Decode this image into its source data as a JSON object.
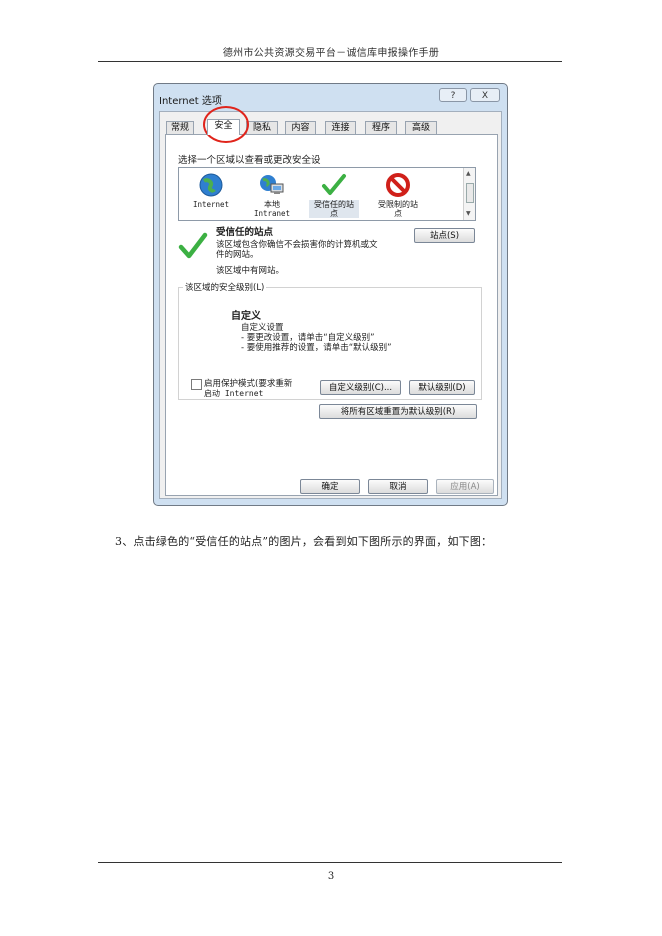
{
  "document": {
    "header": "德州市公共资源交易平台－诚信库申报操作手册",
    "paragraph": "3、点击绿色的“受信任的站点”的图片，会看到如下图所示的界面，如下图：",
    "page_number": "3"
  },
  "dialog": {
    "title": "Internet 选项",
    "help_button": "?",
    "close_button": "X",
    "tabs": [
      "常规",
      "安全",
      "隐私",
      "内容",
      "连接",
      "程序",
      "高级"
    ],
    "active_tab": "安全",
    "zone_prompt": "选择一个区域以查看或更改安全设",
    "zones": [
      {
        "line1": "Internet",
        "line2": "",
        "icon": "globe-icon"
      },
      {
        "line1": "本地",
        "line2": "Intranet",
        "icon": "intranet-icon"
      },
      {
        "line1": "受信任的站",
        "line2": "点",
        "icon": "check-icon",
        "selected": true
      },
      {
        "line1": "受限制的站",
        "line2": "点",
        "icon": "restricted-icon"
      }
    ],
    "selected_zone": {
      "title": "受信任的站点",
      "desc_line1": "该区域包含你确信不会损害你的计算机或文",
      "desc_line2": "件的网站。",
      "desc_line3": "该区域中有网站。",
      "sites_button": "站点(S)"
    },
    "security_level": {
      "group_label": "该区域的安全级别(L)",
      "level_title": "自定义",
      "line1": "自定义设置",
      "line2": "- 要更改设置，请单击“自定义级别”",
      "line3": "- 要使用推荐的设置，请单击“默认级别”"
    },
    "protected_mode": {
      "label_line1": "启用保护模式(要求重新",
      "label_line2": "启动 Internet",
      "checked": false
    },
    "custom_level_button": "自定义级别(C)...",
    "default_level_button": "默认级别(D)",
    "reset_all_button": "将所有区域重置为默认级别(R)",
    "ok_button": "确定",
    "cancel_button": "取消",
    "apply_button": "应用(A)"
  },
  "colors": {
    "highlight_circle": "#e0241b",
    "window_frame": "#cfe0f1",
    "check_green": "#3cb043",
    "restricted_red": "#d0201a"
  }
}
